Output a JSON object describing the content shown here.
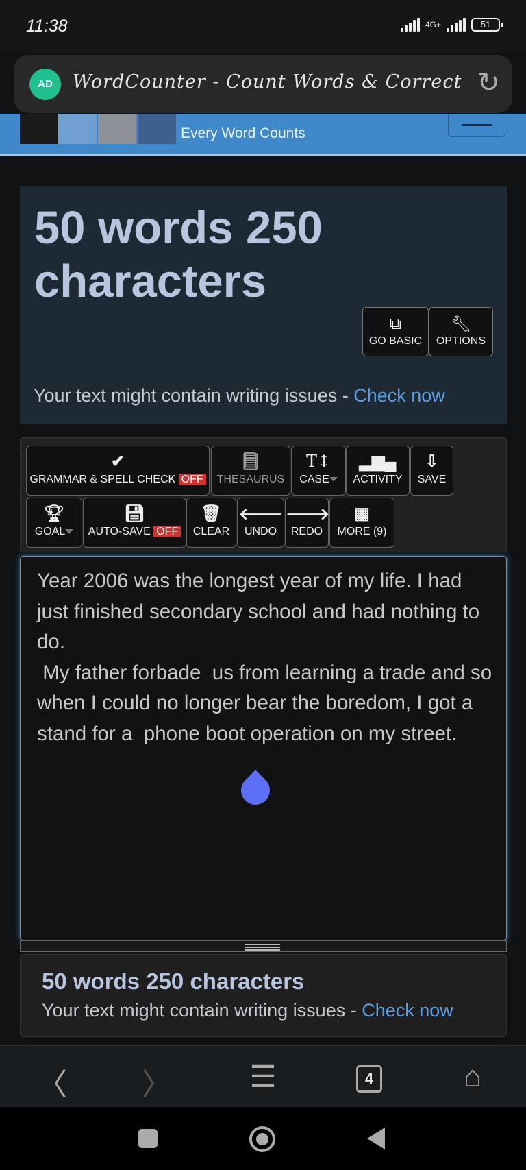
{
  "status_bar": {
    "time": "11:38",
    "network": "4G+",
    "battery": "51"
  },
  "browser": {
    "page_title": "WordCounter - Count Words & Correct",
    "ad_badge": "AD",
    "tab_count": "4"
  },
  "site": {
    "tagline": "Every Word Counts"
  },
  "hero": {
    "title": "50 words 250 characters",
    "go_basic": "GO BASIC",
    "options": "OPTIONS",
    "issue_text": "Your text might contain writing issues - ",
    "check_now": "Check now"
  },
  "toolbar": {
    "grammar": "GRAMMAR & SPELL CHECK",
    "grammar_state": "OFF",
    "thesaurus": "THESAURUS",
    "case": "CASE",
    "activity": "ACTIVITY",
    "save": "SAVE",
    "goal": "GOAL",
    "autosave": "AUTO-SAVE",
    "autosave_state": "OFF",
    "clear": "CLEAR",
    "undo": "UNDO",
    "redo": "REDO",
    "more": "MORE (9)"
  },
  "editor": {
    "text": "Year 2006 was the longest year of my life. I had just finished secondary school and had nothing to do.\n My father forbade  us from learning a trade and so when I could no longer bear the boredom, I got a stand for a  phone boot operation on my street."
  },
  "footer": {
    "title": "50 words 250 characters",
    "issue_text": "Your text might contain writing issues - ",
    "check_now": "Check now"
  },
  "colors": {
    "accent": "#5a9ee0",
    "header_blue": "#3f88c9",
    "off_badge": "#d03030",
    "heading": "#b7c5de"
  }
}
